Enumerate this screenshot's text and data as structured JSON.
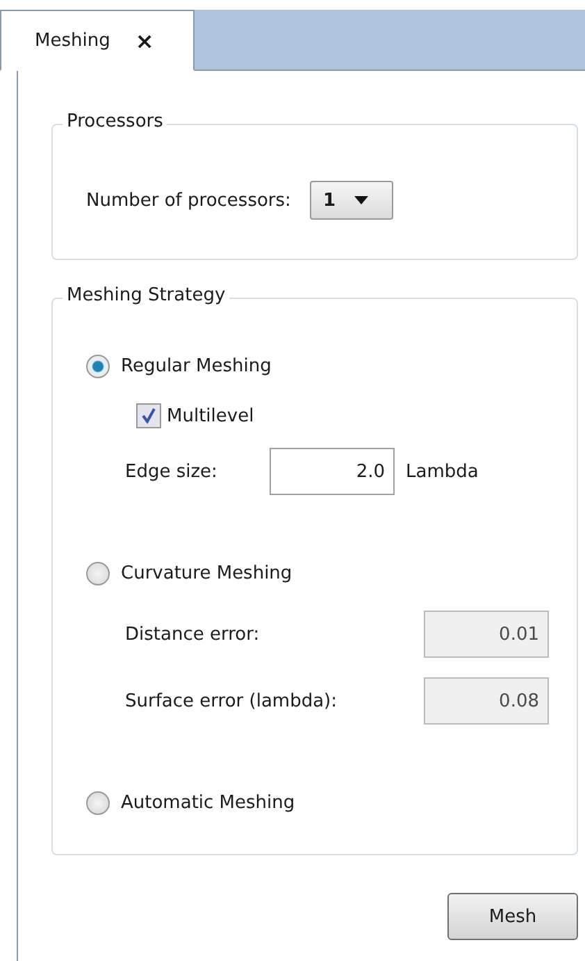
{
  "tabs": [
    {
      "label": "Meshing",
      "selected": true,
      "close": "×"
    }
  ],
  "processors": {
    "title": "Processors",
    "label": "Number of processors:",
    "value": "1"
  },
  "strategy": {
    "title": "Meshing Strategy",
    "options": [
      {
        "label": "Regular Meshing",
        "selected": true,
        "items": [
          {
            "kind": "checkbox",
            "label": "Multilevel",
            "checked": true
          },
          {
            "kind": "field",
            "label": "Edge size:",
            "value": "2.0",
            "unit": "Lambda",
            "disabled": false
          }
        ]
      },
      {
        "label": "Curvature Meshing",
        "selected": false,
        "items": [
          {
            "kind": "field",
            "label": "Distance error:",
            "value": "0.01",
            "disabled": true
          },
          {
            "kind": "field",
            "label": "Surface error (lambda):",
            "value": "0.08",
            "disabled": true
          }
        ]
      },
      {
        "label": "Automatic Meshing",
        "selected": false
      }
    ]
  },
  "buttons": [
    "Mesh"
  ]
}
